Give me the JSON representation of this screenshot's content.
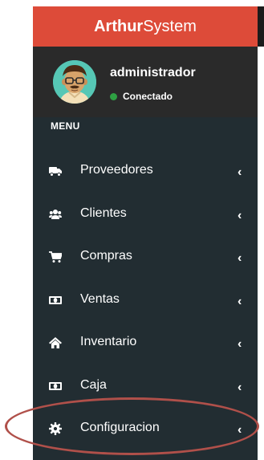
{
  "header": {
    "brand_strong": "Arthur",
    "brand_rest": "System"
  },
  "user_panel": {
    "name": "administrador",
    "status": "Conectado"
  },
  "menu": {
    "header": "MENU",
    "items": [
      {
        "label": "Proveedores",
        "icon": "truck-icon"
      },
      {
        "label": "Clientes",
        "icon": "users-icon"
      },
      {
        "label": "Compras",
        "icon": "shopping-cart-icon"
      },
      {
        "label": "Ventas",
        "icon": "money-icon"
      },
      {
        "label": "Inventario",
        "icon": "home-icon"
      },
      {
        "label": "Caja",
        "icon": "money-icon"
      },
      {
        "label": "Configuracion",
        "icon": "gear-icon"
      }
    ],
    "chevron": "‹"
  },
  "colors": {
    "header_bg": "#dd4b39",
    "sidebar_bg": "#222d32",
    "user_panel_bg": "#2a2a2a",
    "status_online": "#2ea043",
    "annotation_oval": "#b0504a"
  }
}
